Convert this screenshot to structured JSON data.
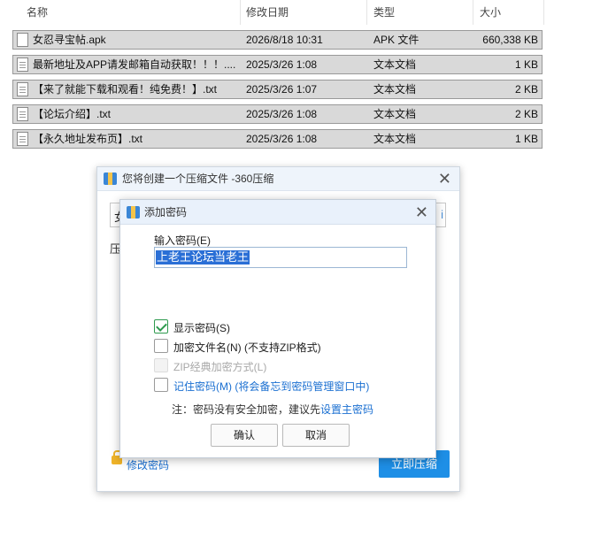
{
  "explorer": {
    "columns": {
      "name": "名称",
      "modified": "修改日期",
      "type": "类型",
      "size": "大小"
    },
    "files": [
      {
        "name": "女忍寻宝帖.apk",
        "modified": "2026/8/18 10:31",
        "type": "APK 文件",
        "size": "660,338 KB",
        "icon": "apk-file-icon"
      },
      {
        "name": "最新地址及APP请发邮箱自动获取！！！....",
        "modified": "2025/3/26 1:08",
        "type": "文本文档",
        "size": "1 KB",
        "icon": "text-file-icon"
      },
      {
        "name": "【来了就能下载和观看！纯免费！】.txt",
        "modified": "2025/3/26 1:07",
        "type": "文本文档",
        "size": "2 KB",
        "icon": "text-file-icon"
      },
      {
        "name": "【论坛介绍】.txt",
        "modified": "2025/3/26 1:08",
        "type": "文本文档",
        "size": "2 KB",
        "icon": "text-file-icon"
      },
      {
        "name": "【永久地址发布页】.txt",
        "modified": "2025/3/26 1:08",
        "type": "文本文档",
        "size": "1 KB",
        "icon": "text-file-icon"
      }
    ]
  },
  "main_dialog": {
    "title": "您将创建一个压缩文件 -360压缩",
    "close": "✕",
    "archive_name_partial": "女",
    "archive_name_end": "i",
    "label_partial": "压",
    "modify_password": "修改密码",
    "compress_now": "立即压缩"
  },
  "password_dialog": {
    "title": "添加密码",
    "close": "✕",
    "input_label": "输入密码(E)",
    "password_value": "上老王论坛当老王",
    "options": {
      "show_password": {
        "label": "显示密码(S)",
        "checked": true
      },
      "encrypt_filenames": {
        "label": "加密文件名(N) (不支持ZIP格式)",
        "checked": false
      },
      "zip_classic": {
        "label": "ZIP经典加密方式(L)",
        "checked": false,
        "disabled": true
      },
      "remember_password": {
        "label": "记住密码(M) (将会备忘到密码管理窗口中)",
        "checked": false
      }
    },
    "note_prefix": "注：密码没有安全加密，建议先",
    "note_link": "设置主密码",
    "ok": "确认",
    "cancel": "取消"
  }
}
